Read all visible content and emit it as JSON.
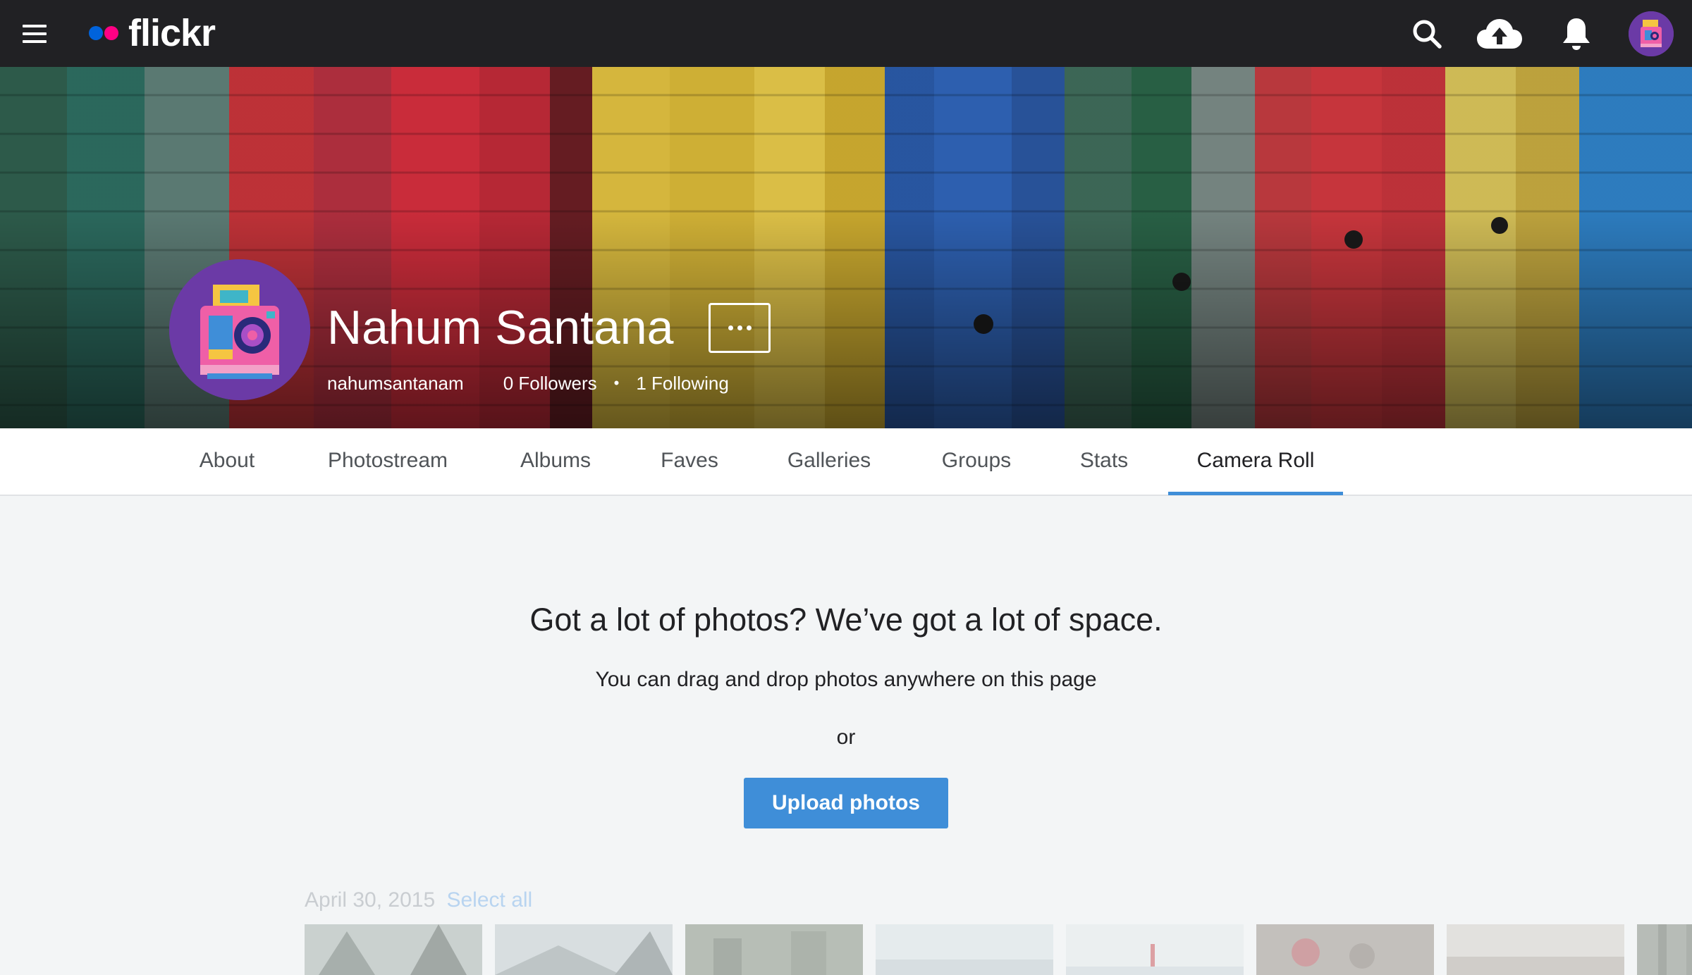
{
  "topbar": {
    "logo_text": "flickr",
    "icons": [
      "menu-icon",
      "search-icon",
      "upload-cloud-icon",
      "notification-bell-icon",
      "user-avatar"
    ]
  },
  "profile": {
    "name": "Nahum Santana",
    "username": "nahumsantanam",
    "followers": "0 Followers",
    "following": "1 Following",
    "separator": "•"
  },
  "tabs": [
    {
      "label": "About"
    },
    {
      "label": "Photostream"
    },
    {
      "label": "Albums"
    },
    {
      "label": "Faves"
    },
    {
      "label": "Galleries"
    },
    {
      "label": "Groups"
    },
    {
      "label": "Stats"
    },
    {
      "label": "Camera Roll",
      "active": true
    }
  ],
  "empty_state": {
    "headline": "Got a lot of photos? We’ve got a lot of space.",
    "subtext": "You can drag and drop photos anywhere on this page",
    "or": "or",
    "upload_button": "Upload photos"
  },
  "camera_roll": {
    "date": "April 30, 2015",
    "select_all": "Select all"
  },
  "colors": {
    "topbar_bg": "#212124",
    "accent_blue": "#3f8ed8",
    "logo_blue": "#0063dc",
    "logo_pink": "#ff0084",
    "page_bg": "#f3f5f6"
  }
}
